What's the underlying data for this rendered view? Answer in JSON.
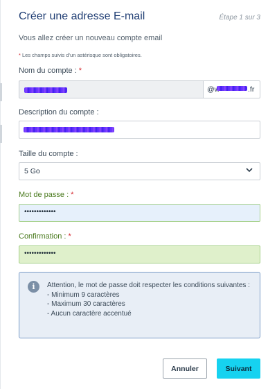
{
  "header": {
    "title": "Créer une adresse E-mail",
    "step": "Étape 1 sur 3"
  },
  "intro": "Vous allez créer un nouveau compte email",
  "note": {
    "star": "*",
    "text": " Les champs suivis d'un astérisque sont obligatoires."
  },
  "fields": {
    "account_name": {
      "label": "Nom du compte :",
      "required_mark": "*",
      "domain_prefix": "@w",
      "domain_suffix": ".fr"
    },
    "account_description": {
      "label": "Description du compte :"
    },
    "account_size": {
      "label": "Taille du compte :",
      "value": "5 Go"
    },
    "password": {
      "label": "Mot de passe :",
      "required_mark": "*",
      "value": "•••••••••••••"
    },
    "confirmation": {
      "label": "Confirmation :",
      "required_mark": "*",
      "value": "•••••••••••••"
    }
  },
  "info": {
    "icon": "info-icon",
    "text": "Attention, le mot de passe doit respecter les conditions suivantes :",
    "rules": [
      "- Minimum 9 caractères",
      "- Maximum 30 caractères",
      "- Aucun caractère accentué"
    ]
  },
  "buttons": {
    "cancel": "Annuler",
    "submit": "Suivant"
  },
  "colors": {
    "title": "#1f3d73",
    "required": "#d4252c",
    "green_label": "#4a7a1e",
    "submit_button": "#16d2f0"
  }
}
